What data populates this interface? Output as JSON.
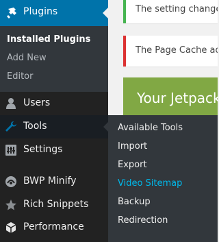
{
  "colors": {
    "sidebar_bg": "#222222",
    "submenu_bg": "#32373c",
    "active_menu_bg": "#0073aa",
    "link_active": "#00b9eb",
    "notice_success": "#46b450",
    "notice_error": "#dc3232",
    "jetpack_green": "#81a844"
  },
  "sidebar": {
    "active": {
      "label": "Plugins",
      "icon": "plugins-icon"
    },
    "submenu": [
      {
        "label": "Installed Plugins",
        "current": true
      },
      {
        "label": "Add New"
      },
      {
        "label": "Editor"
      }
    ],
    "items": [
      {
        "label": "Users",
        "icon": "users-icon"
      },
      {
        "label": "Tools",
        "icon": "tools-icon"
      },
      {
        "label": "Settings",
        "icon": "settings-icon"
      },
      {
        "label": "BWP Minify",
        "icon": "bwp-minify-icon"
      },
      {
        "label": "Rich Snippets",
        "icon": "rich-snippets-star-icon"
      },
      {
        "label": "Performance",
        "icon": "performance-cube-icon"
      }
    ]
  },
  "flyout": {
    "items": [
      {
        "label": "Available Tools"
      },
      {
        "label": "Import"
      },
      {
        "label": "Export"
      },
      {
        "label": "Video Sitemap",
        "active": true
      },
      {
        "label": "Backup"
      },
      {
        "label": "Redirection"
      }
    ]
  },
  "main": {
    "notices": [
      {
        "text": "The setting change(s",
        "type": "success"
      },
      {
        "text": "The Page Cache add",
        "type": "error"
      }
    ],
    "jetpack_banner": "Your Jetpack"
  }
}
